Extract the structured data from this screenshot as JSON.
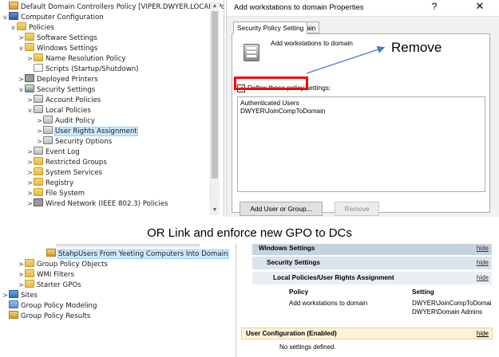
{
  "top_tree": {
    "items": [
      {
        "label": "Default Domain Controllers Policy [VIPER.DWYER.LOCAL] Poli",
        "twisty": "",
        "icon": "gpo-icon"
      },
      {
        "label": "Computer Configuration",
        "twisty": "v",
        "icon": "computer-icon"
      },
      {
        "label": "Policies",
        "twisty": "v",
        "icon": "folder-icon"
      },
      {
        "label": "Software Settings",
        "twisty": ">",
        "icon": "folder-icon"
      },
      {
        "label": "Windows Settings",
        "twisty": "v",
        "icon": "folder-icon"
      },
      {
        "label": "Name Resolution Policy",
        "twisty": ">",
        "icon": "folder-icon"
      },
      {
        "label": "Scripts (Startup/Shutdown)",
        "twisty": "",
        "icon": "script-icon"
      },
      {
        "label": "Deployed Printers",
        "twisty": ">",
        "icon": "printer-icon"
      },
      {
        "label": "Security Settings",
        "twisty": "v",
        "icon": "shield-icon"
      },
      {
        "label": "Account Policies",
        "twisty": ">",
        "icon": "policy-icon"
      },
      {
        "label": "Local Policies",
        "twisty": "v",
        "icon": "policy-icon"
      },
      {
        "label": "Audit Policy",
        "twisty": ">",
        "icon": "policy-icon"
      },
      {
        "label": "User Rights Assignment",
        "twisty": ">",
        "icon": "policy-icon",
        "selected": true
      },
      {
        "label": "Security Options",
        "twisty": ">",
        "icon": "policy-icon"
      },
      {
        "label": "Event Log",
        "twisty": ">",
        "icon": "policy-icon"
      },
      {
        "label": "Restricted Groups",
        "twisty": ">",
        "icon": "folder-icon"
      },
      {
        "label": "System Services",
        "twisty": ">",
        "icon": "folder-icon"
      },
      {
        "label": "Registry",
        "twisty": ">",
        "icon": "folder-icon"
      },
      {
        "label": "File System",
        "twisty": ">",
        "icon": "folder-icon"
      },
      {
        "label": "Wired Network (IEEE 802.3) Policies",
        "twisty": ">",
        "icon": "network-icon"
      }
    ],
    "scroll_up": "▲",
    "scroll_down": "▼"
  },
  "dialog": {
    "title": "Add workstations to domain Properties",
    "help_glyph": "?",
    "close_glyph": "✕",
    "tabs": [
      "Security Policy Setting",
      "Explain"
    ],
    "policy_name": "Add workstations to domain",
    "define_label": "Define these policy settings:",
    "define_checked": "✓",
    "members": [
      "Authenticated Users",
      "DWYER\\JoinCompToDomain"
    ],
    "add_button": "Add User or Group...",
    "remove_button": "Remove"
  },
  "annotation": {
    "label": "Remove",
    "color": "#ff0000",
    "arrow_color": "#4a7bd0"
  },
  "caption": "OR Link and enforce new GPO to DCs",
  "bottom_tree": {
    "items": [
      {
        "label": "StahpUsers From Yeeting Computers Into Domain",
        "twisty": "",
        "icon": "gpo-icon",
        "selected": true
      },
      {
        "label": "Group Policy Objects",
        "twisty": ">",
        "icon": "folder-icon"
      },
      {
        "label": "WMI Filters",
        "twisty": ">",
        "icon": "folder-icon"
      },
      {
        "label": "Starter GPOs",
        "twisty": ">",
        "icon": "folder-icon"
      },
      {
        "label": "Sites",
        "twisty": ">",
        "icon": "sites-icon"
      },
      {
        "label": "Group Policy Modeling",
        "twisty": "",
        "icon": "modeling-icon"
      },
      {
        "label": "Group Policy Results",
        "twisty": "",
        "icon": "results-icon"
      }
    ]
  },
  "report": {
    "windows_settings": "Windows Settings",
    "security_settings": "Security Settings",
    "local_policies": "Local Policies/User Rights Assignment",
    "hide": "hide",
    "col_policy": "Policy",
    "col_setting": "Setting",
    "row_policy": "Add workstations to domain",
    "row_settings": [
      "DWYER\\JoinCompToDomai",
      "DWYER\\Domain Admins"
    ],
    "user_config": "User Configuration (Enabled)",
    "no_settings": "No settings defined."
  }
}
